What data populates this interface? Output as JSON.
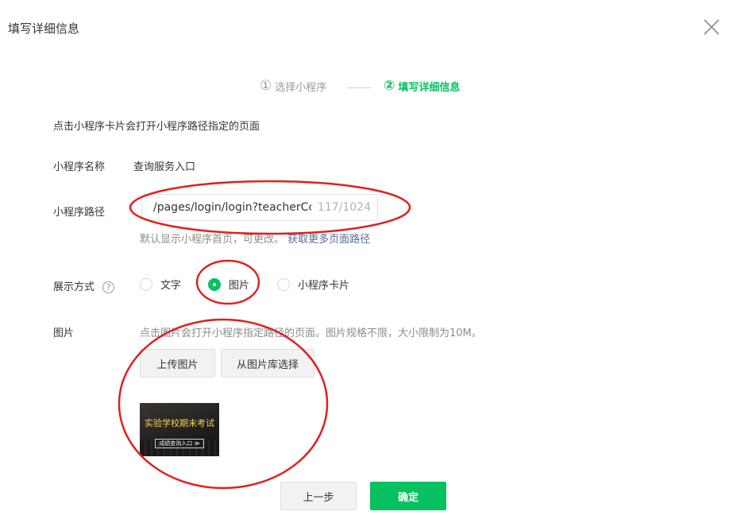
{
  "dialog": {
    "title": "填写详细信息"
  },
  "steps": [
    {
      "num": "①",
      "label": "选择小程序"
    },
    {
      "num": "②",
      "label": "填写详细信息"
    }
  ],
  "intro": "点击小程序卡片会打开小程序路径指定的页面",
  "fields": {
    "name_label": "小程序名称",
    "name_value": "查询服务入口",
    "path_label": "小程序路径",
    "path_value": "/pages/login/login?teacherCc",
    "path_count": "117/1024",
    "path_hint": "默认显示小程序首页，可更改。",
    "path_link": "获取更多页面路径",
    "display_label": "展示方式",
    "display_help": "?",
    "display_options": [
      {
        "label": "文字",
        "checked": false
      },
      {
        "label": "图片",
        "checked": true
      },
      {
        "label": "小程序卡片",
        "checked": false
      }
    ],
    "image_label": "图片",
    "image_hint": "点击图片会打开小程序指定路径的页面。图片规格不限，大小限制为10M。",
    "upload_label": "上传图片",
    "library_label": "从图片库选择"
  },
  "thumbnail": {
    "headline": "实验学校期末考试",
    "button": "成绩查询入口 ≫"
  },
  "footer": {
    "prev_label": "上一步",
    "confirm_label": "确定"
  },
  "colors": {
    "accent": "#07c160",
    "link": "#576b95",
    "annotation": "#e02020"
  }
}
